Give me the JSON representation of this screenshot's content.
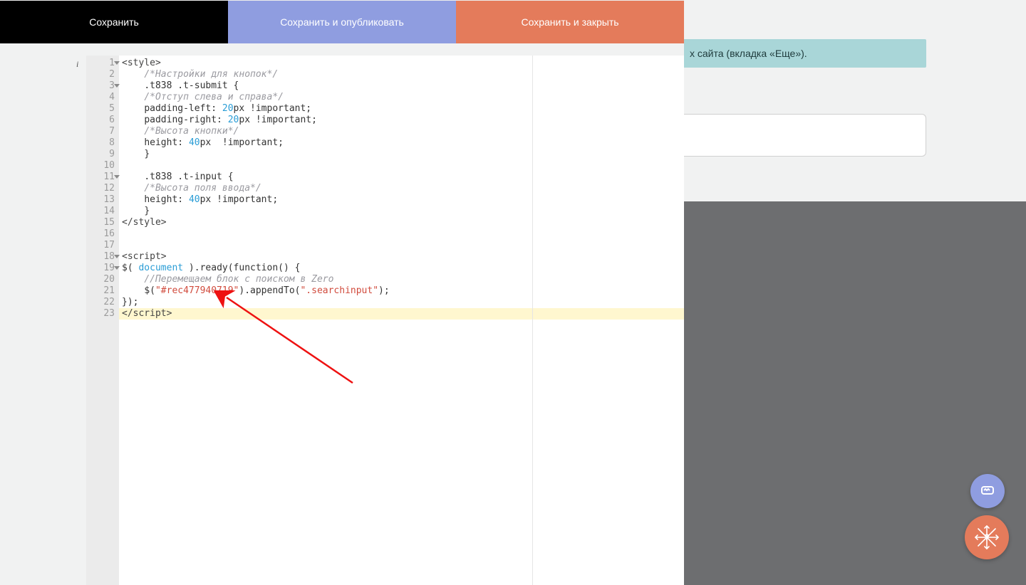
{
  "toolbar": {
    "save": "Сохранить",
    "publish": "Сохранить и опубликовать",
    "close": "Сохранить и закрыть"
  },
  "hint": "х сайта (вкладка «Еще»).",
  "editor": {
    "lines": [
      {
        "n": 1,
        "fold": true,
        "info": true
      },
      {
        "n": 2
      },
      {
        "n": 3,
        "fold": true
      },
      {
        "n": 4
      },
      {
        "n": 5
      },
      {
        "n": 6
      },
      {
        "n": 7
      },
      {
        "n": 8
      },
      {
        "n": 9
      },
      {
        "n": 10
      },
      {
        "n": 11,
        "fold": true
      },
      {
        "n": 12
      },
      {
        "n": 13
      },
      {
        "n": 14
      },
      {
        "n": 15
      },
      {
        "n": 16
      },
      {
        "n": 17
      },
      {
        "n": 18,
        "fold": true
      },
      {
        "n": 19,
        "fold": true
      },
      {
        "n": 20
      },
      {
        "n": 21
      },
      {
        "n": 22
      },
      {
        "n": 23,
        "hl": true
      }
    ],
    "t": {
      "style_open": "<style>",
      "cmt_buttons": "/*Настройки для кнопок*/",
      "sel_submit": ".t838 .t-submit {",
      "cmt_padding": "/*Отступ слева и справа*/",
      "pad_left_a": "padding-left: ",
      "pad_left_b": "px !important;",
      "pad_right_a": "padding-right: ",
      "pad_right_b": "px !important;",
      "cmt_height_btn": "/*Высота кнопки*/",
      "height_a": "height: ",
      "height_b": "px  !important;",
      "brace_close": "}",
      "sel_input": ".t838 .t-input {",
      "cmt_height_input": "/*Высота поля ввода*/",
      "height2_b": "px !important;",
      "style_close": "</style>",
      "script_open": "<script>",
      "ready_a": "$( ",
      "ready_doc": "document",
      "ready_b": " ).ready(function() {",
      "cmt_move": "//Перемещаем блок с поиском в Zero",
      "jq_a": "$(",
      "str_rec": "\"#rec477940719\"",
      "jq_b": ").appendTo(",
      "str_search": "\".searchinput\"",
      "jq_c": ");",
      "ready_close": "});",
      "script_close": "</script>",
      "n20": "20",
      "n40": "40"
    }
  }
}
